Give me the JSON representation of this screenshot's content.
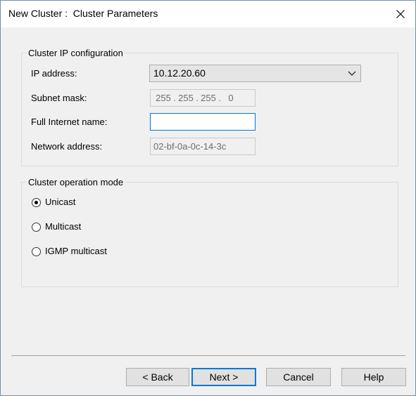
{
  "window": {
    "title": "New Cluster :  Cluster Parameters"
  },
  "ip_config": {
    "group_title": "Cluster IP configuration",
    "ip_address_label": "IP address:",
    "ip_address_value": "10.12.20.60",
    "subnet_label": "Subnet mask:",
    "subnet_octets": [
      "255",
      "255",
      "255",
      "0"
    ],
    "full_name_label": "Full Internet name:",
    "full_name_value": "",
    "network_address_label": "Network address:",
    "network_address_value": "02-bf-0a-0c-14-3c"
  },
  "operation_mode": {
    "group_title": "Cluster operation mode",
    "options": [
      {
        "label": "Unicast",
        "selected": true
      },
      {
        "label": "Multicast",
        "selected": false
      },
      {
        "label": "IGMP multicast",
        "selected": false
      }
    ]
  },
  "buttons": {
    "back": "< Back",
    "next": "Next >",
    "cancel": "Cancel",
    "help": "Help"
  },
  "icons": {
    "close": "close-icon",
    "dropdown": "chevron-down-icon"
  }
}
